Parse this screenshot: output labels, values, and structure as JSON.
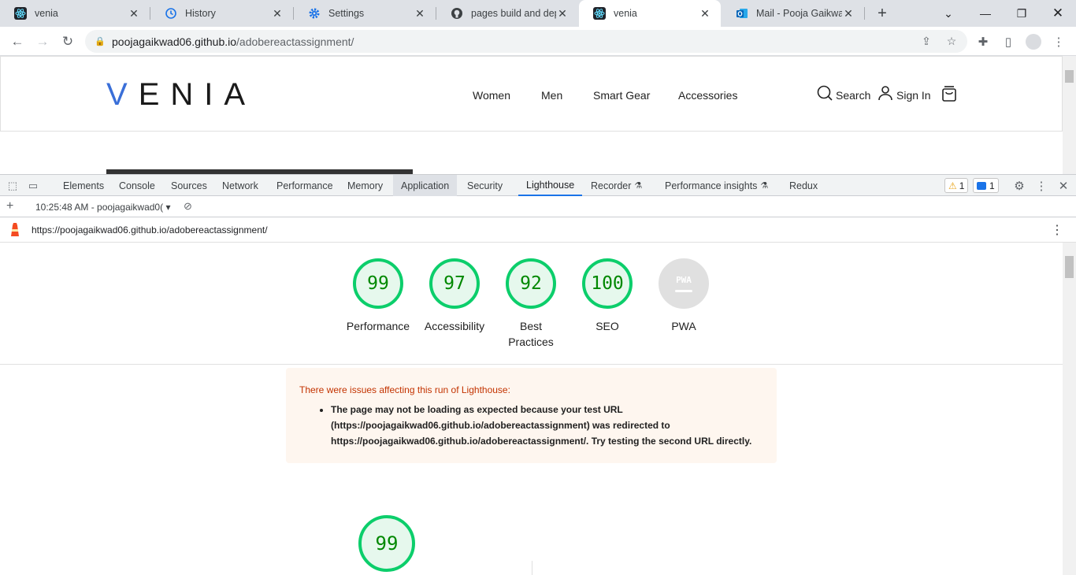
{
  "browser": {
    "tabs": [
      {
        "title": "venia",
        "icon": "react-icon",
        "active": false
      },
      {
        "title": "History",
        "icon": "history-icon",
        "active": false
      },
      {
        "title": "Settings",
        "icon": "settings-gear-icon",
        "active": false
      },
      {
        "title": "pages build and deplo",
        "icon": "github-icon",
        "active": false
      },
      {
        "title": "venia",
        "icon": "react-icon",
        "active": true
      },
      {
        "title": "Mail - Pooja Gaikwad",
        "icon": "outlook-icon",
        "active": false
      }
    ],
    "address": {
      "host": "poojagaikwad06.github.io",
      "path": "/adobereactassignment/"
    }
  },
  "site": {
    "logo": "VENIA",
    "nav": [
      "Women",
      "Men",
      "Smart Gear",
      "Accessories"
    ],
    "search_label": "Search",
    "signin_label": "Sign In"
  },
  "devtools": {
    "tabs": [
      "Elements",
      "Console",
      "Sources",
      "Network",
      "Performance",
      "Memory",
      "Application",
      "Security",
      "Lighthouse",
      "Recorder",
      "Performance insights",
      "Redux"
    ],
    "warning_count": "1",
    "message_count": "1",
    "report_selector": "10:25:48 AM - poojagaikwad0(",
    "report_url": "https://poojagaikwad06.github.io/adobereactassignment/"
  },
  "lighthouse": {
    "scores": [
      {
        "value": "99",
        "label": "Performance"
      },
      {
        "value": "97",
        "label": "Accessibility"
      },
      {
        "value": "92",
        "label": "Best Practices"
      },
      {
        "value": "100",
        "label": "SEO"
      },
      {
        "value": "PWA",
        "label": "PWA"
      }
    ],
    "warning_title": "There were issues affecting this run of Lighthouse:",
    "warning_text": "The page may not be loading as expected because your test URL (https://poojagaikwad06.github.io/adobereactassignment) was redirected to https://poojagaikwad06.github.io/adobereactassignment/. Try testing the second URL directly.",
    "performance_score": "99"
  },
  "colors": {
    "pass": "#0cce6b",
    "pass_text": "#008800",
    "accent": "#1a73e8",
    "warning_title": "#c33300"
  }
}
